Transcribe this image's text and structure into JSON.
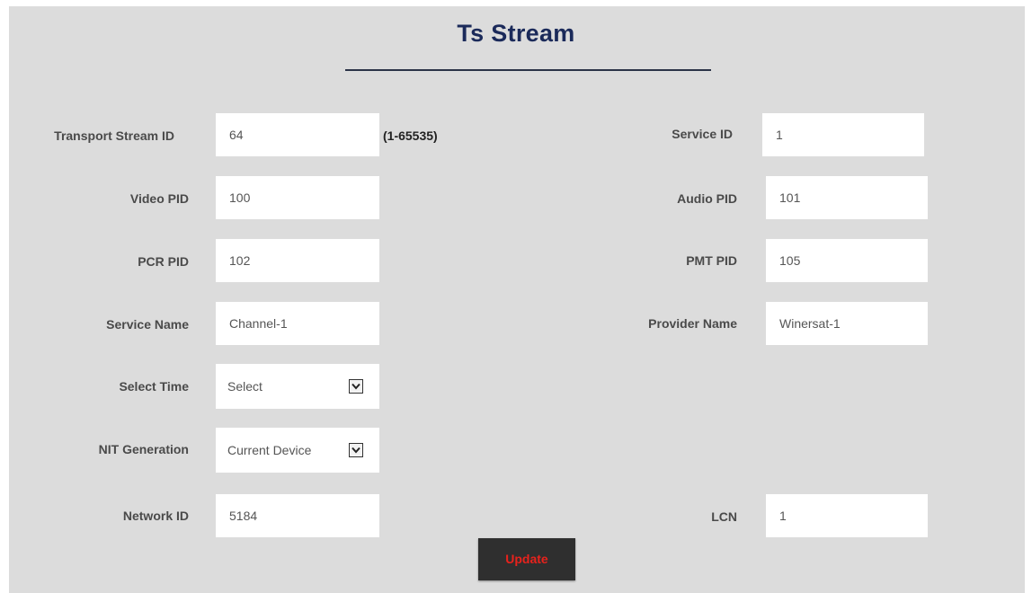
{
  "title": "Ts Stream",
  "left_fields": [
    {
      "label": "Transport Stream ID",
      "value": "64",
      "hint": "(1-65535)"
    },
    {
      "label": "Video PID",
      "value": "100"
    },
    {
      "label": "PCR PID",
      "value": "102"
    },
    {
      "label": "Service Name",
      "value": "Channel-1"
    },
    {
      "label": "Select Time",
      "value": "Select"
    },
    {
      "label": "NIT Generation",
      "value": "Current Device"
    },
    {
      "label": "Network ID",
      "value": "5184"
    }
  ],
  "right_fields": [
    {
      "label": "Service ID",
      "value": "1"
    },
    {
      "label": "Audio PID",
      "value": "101"
    },
    {
      "label": "PMT PID",
      "value": "105"
    },
    {
      "label": "Provider Name",
      "value": "Winersat-1"
    },
    {
      "label": "LCN",
      "value": "1"
    }
  ],
  "icons": {
    "dropdown": "chevron-down-icon"
  },
  "colors": {
    "background": "#dcdcdc",
    "title": "#1b2a5a",
    "button_bg": "#2f2f2f",
    "button_text": "#e8221c"
  },
  "update_label": "Update"
}
